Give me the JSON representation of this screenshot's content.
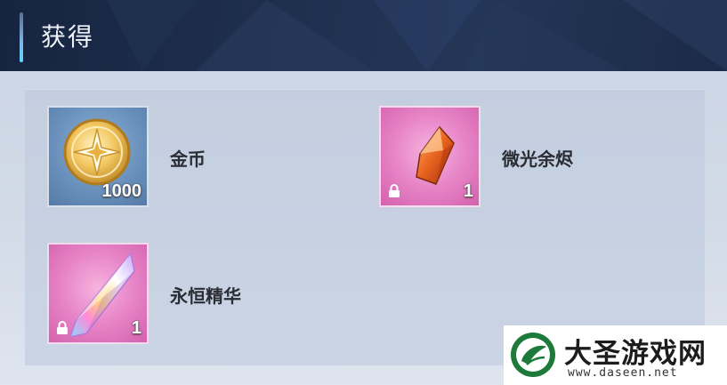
{
  "header": {
    "title": "获得"
  },
  "items": [
    {
      "name": "金币",
      "quantity": "1000",
      "icon": "gold-coin-icon",
      "locked": false,
      "frame": "blue"
    },
    {
      "name": "微光余烬",
      "quantity": "1",
      "icon": "orange-crystal-icon",
      "locked": true,
      "frame": "pink"
    },
    {
      "name": "永恒精华",
      "quantity": "1",
      "icon": "rainbow-crystal-icon",
      "locked": true,
      "frame": "pink"
    }
  ],
  "watermark": {
    "title": "大圣游戏网",
    "url": "www.daseen.net"
  },
  "colors": {
    "header_bg": "#1e2e4d",
    "blue_frame": "#6b92bd",
    "pink_frame": "#e784c7",
    "accent": "#5fd6ff"
  }
}
